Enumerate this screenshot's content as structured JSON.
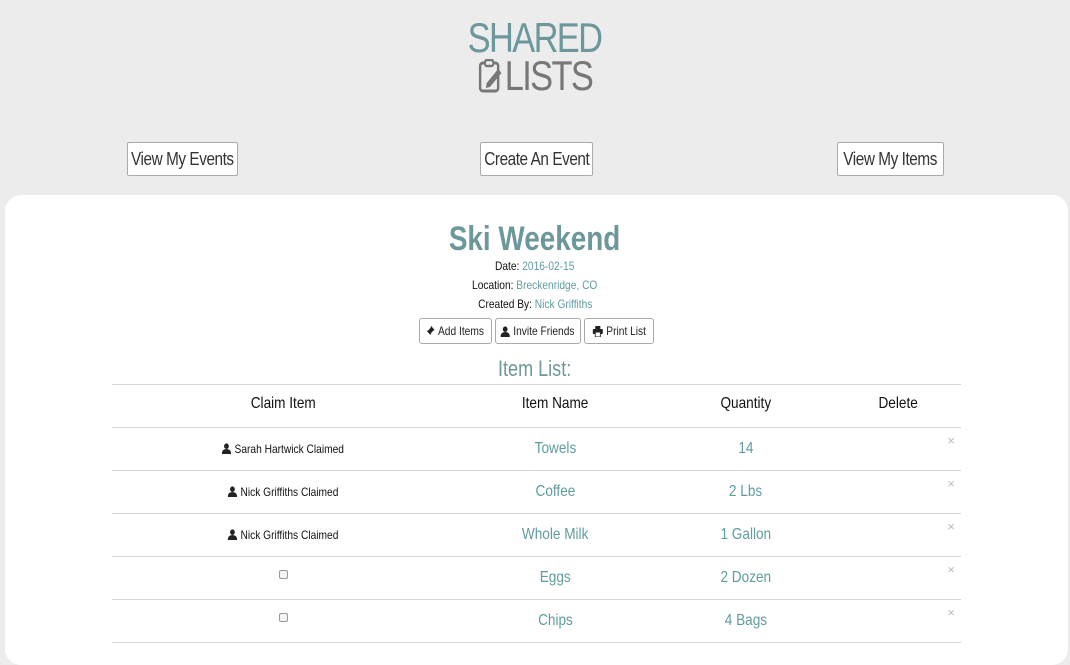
{
  "logo": {
    "line1": "SHARED",
    "line2": "LISTS"
  },
  "nav": {
    "view_events": "View My Events",
    "create_event": "Create An Event",
    "view_items": "View My Items"
  },
  "event": {
    "title": "Ski Weekend",
    "date_label": "Date:",
    "date_value": "2016-02-15",
    "location_label": "Location:",
    "location_value": "Breckenridge, CO",
    "created_label": "Created By:",
    "created_value": "Nick Griffiths"
  },
  "actions": {
    "add_items": "Add Items",
    "invite_friends": "Invite Friends",
    "print_list": "Print List"
  },
  "item_list": {
    "label": "Item List:",
    "headers": {
      "claim": "Claim Item",
      "name": "Item Name",
      "quantity": "Quantity",
      "delete": "Delete"
    },
    "rows": [
      {
        "claim": "Sarah Hartwick Claimed",
        "claimed": true,
        "name": "Towels",
        "quantity": "14",
        "delete": "×"
      },
      {
        "claim": "Nick Griffiths Claimed",
        "claimed": true,
        "name": "Coffee",
        "quantity": "2 Lbs",
        "delete": "×"
      },
      {
        "claim": "Nick Griffiths Claimed",
        "claimed": true,
        "name": "Whole Milk",
        "quantity": "1 Gallon",
        "delete": "×"
      },
      {
        "claim": "",
        "claimed": false,
        "name": "Eggs",
        "quantity": "2 Dozen",
        "delete": "×"
      },
      {
        "claim": "",
        "claimed": false,
        "name": "Chips",
        "quantity": "4 Bags",
        "delete": "×"
      }
    ]
  },
  "colors": {
    "accent": "#6d989b",
    "link": "#5f9ca0",
    "background": "#ececec"
  }
}
